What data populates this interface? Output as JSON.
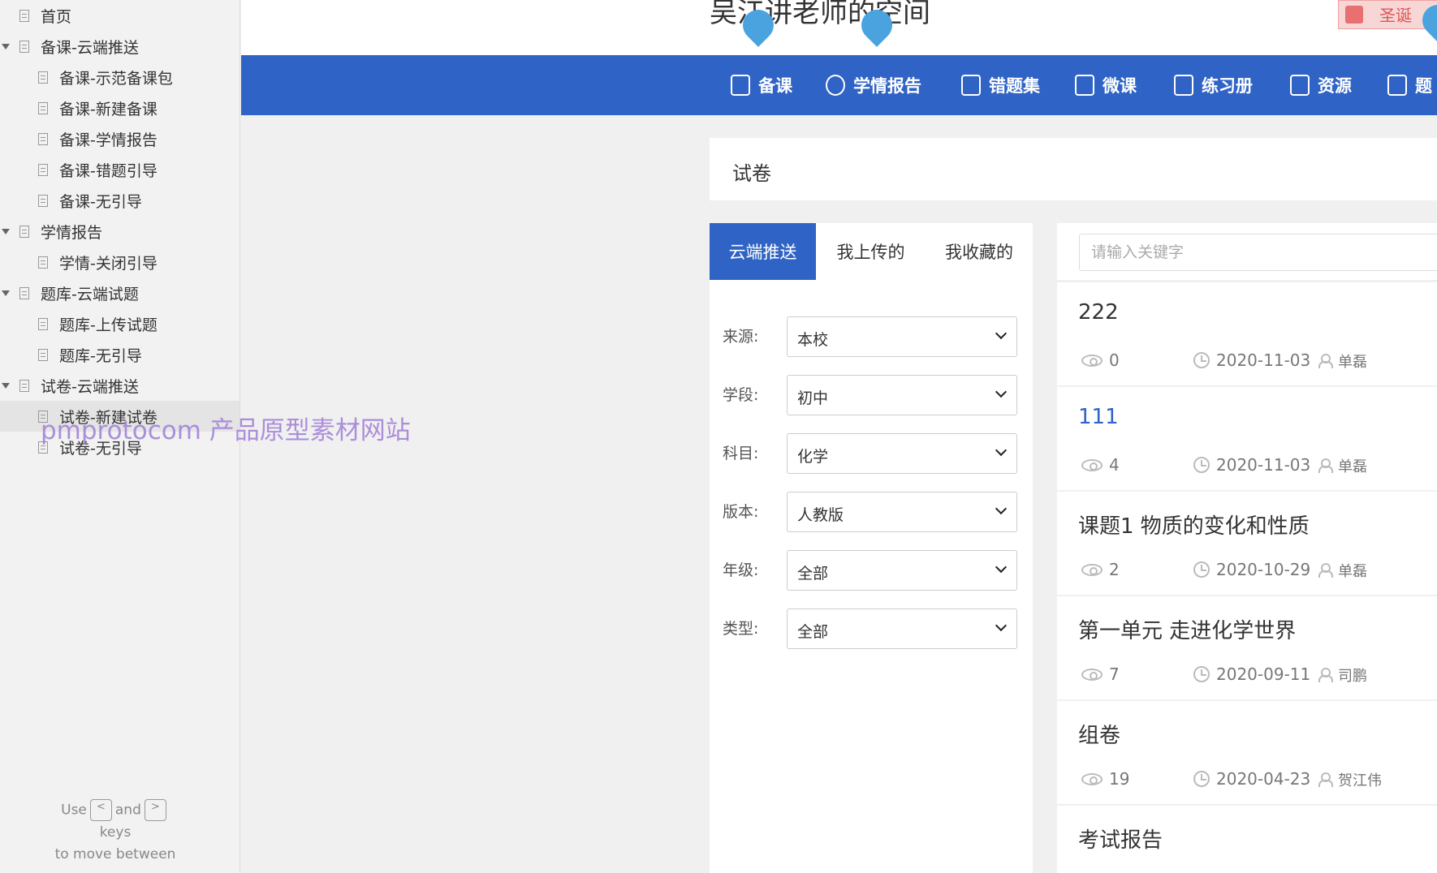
{
  "sidebar": {
    "items": [
      {
        "label": "首页"
      },
      {
        "label": "备课-云端推送"
      },
      {
        "label": "备课-示范备课包"
      },
      {
        "label": "备课-新建备课"
      },
      {
        "label": "备课-学情报告"
      },
      {
        "label": "备课-错题引导"
      },
      {
        "label": "备课-无引导"
      },
      {
        "label": "学情报告"
      },
      {
        "label": "学情-关闭引导"
      },
      {
        "label": "题库-云端试题"
      },
      {
        "label": "题库-上传试题"
      },
      {
        "label": "题库-无引导"
      },
      {
        "label": "试卷-云端推送"
      },
      {
        "label": "试卷-新建试卷"
      },
      {
        "label": "试卷-无引导"
      }
    ],
    "hint": {
      "use": "Use",
      "and": "and",
      "keys": "keys",
      "move": "to move between",
      "prev_key": "<",
      "next_key": ">"
    }
  },
  "watermark": "pmprotocom 产品原型素材网站",
  "header": {
    "title": "吴江讲老师的空间",
    "notice": "圣诞"
  },
  "nav": {
    "items": [
      {
        "label": "备课",
        "icon": "document-icon"
      },
      {
        "label": "学情报告",
        "icon": "clock-chart-icon"
      },
      {
        "label": "错题集",
        "icon": "book-icon"
      },
      {
        "label": "微课",
        "icon": "video-icon"
      },
      {
        "label": "练习册",
        "icon": "notebook-icon"
      },
      {
        "label": "资源",
        "icon": "briefcase-icon"
      },
      {
        "label": "题",
        "icon": "clipboard-icon"
      }
    ]
  },
  "section": {
    "title": "试卷"
  },
  "tabs": [
    {
      "label": "云端推送"
    },
    {
      "label": "我上传的"
    },
    {
      "label": "我收藏的"
    }
  ],
  "filters": [
    {
      "label": "来源:",
      "value": "本校"
    },
    {
      "label": "学段:",
      "value": "初中"
    },
    {
      "label": "科目:",
      "value": "化学"
    },
    {
      "label": "版本:",
      "value": "人教版"
    },
    {
      "label": "年级:",
      "value": "全部"
    },
    {
      "label": "类型:",
      "value": "全部"
    }
  ],
  "search": {
    "placeholder": "请输入关键字"
  },
  "papers": [
    {
      "title": "222",
      "views": "0",
      "date": "2020-11-03",
      "author": "单磊"
    },
    {
      "title": "111",
      "views": "4",
      "date": "2020-11-03",
      "author": "单磊"
    },
    {
      "title": "课题1 物质的变化和性质",
      "views": "2",
      "date": "2020-10-29",
      "author": "单磊"
    },
    {
      "title": "第一单元 走进化学世界",
      "views": "7",
      "date": "2020-09-11",
      "author": "司鹏"
    },
    {
      "title": "组卷",
      "views": "19",
      "date": "2020-04-23",
      "author": "贺江伟"
    },
    {
      "title": "考试报告"
    }
  ],
  "colors": {
    "primary": "#2f63c5",
    "pin": "#4aa3df",
    "watermark": "#a07ed6"
  }
}
